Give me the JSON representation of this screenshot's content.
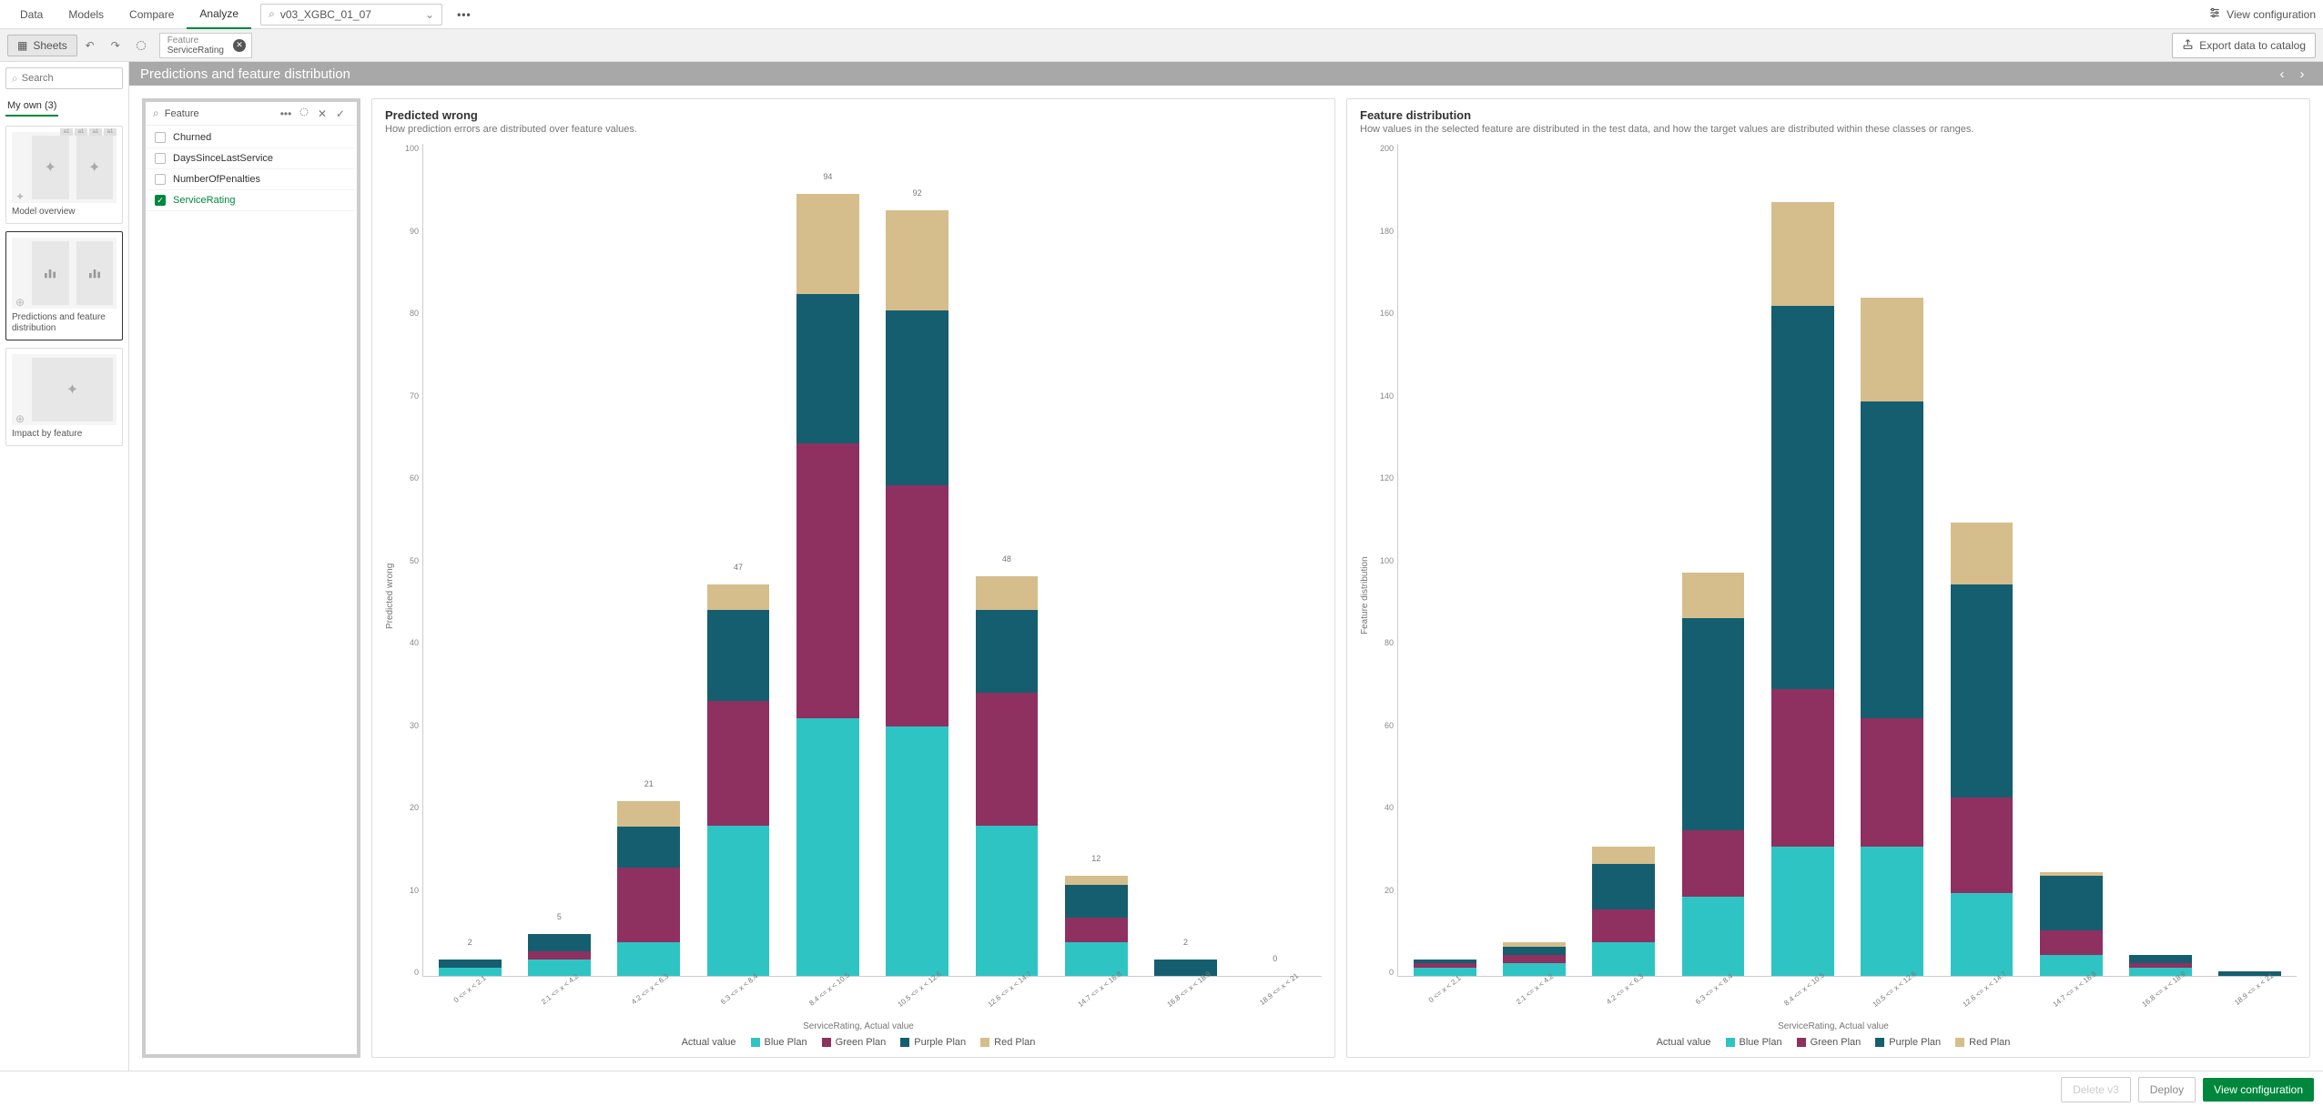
{
  "topnav": {
    "tabs": [
      "Data",
      "Models",
      "Compare",
      "Analyze"
    ],
    "active_tab": "Analyze",
    "model_dropdown": "v03_XGBC_01_07",
    "view_config": "View configuration"
  },
  "toolbar": {
    "sheets": "Sheets",
    "chip": {
      "label": "Feature",
      "value": "ServiceRating"
    },
    "export": "Export data to catalog"
  },
  "sidebar": {
    "search_placeholder": "Search",
    "myown": "My own (3)",
    "thumbs": [
      {
        "caption": "Model overview"
      },
      {
        "caption": "Predictions and feature distribution",
        "selected": true
      },
      {
        "caption": "Impact by feature"
      }
    ]
  },
  "header": {
    "title": "Predictions and feature distribution"
  },
  "feature_panel": {
    "title": "Feature",
    "items": [
      {
        "label": "Churned",
        "checked": false
      },
      {
        "label": "DaysSinceLastService",
        "checked": false
      },
      {
        "label": "NumberOfPenalties",
        "checked": false
      },
      {
        "label": "ServiceRating",
        "checked": true
      }
    ]
  },
  "legend": {
    "title": "Actual value",
    "series": [
      "Blue Plan",
      "Green Plan",
      "Purple Plan",
      "Red Plan"
    ],
    "colors": {
      "Blue Plan": "#2fc4c4",
      "Green Plan": "#8e3060",
      "Purple Plan": "#155e6f",
      "Red Plan": "#d6bd8c"
    }
  },
  "xlabel": "ServiceRating, Actual value",
  "chart_data": [
    {
      "title": "Predicted wrong",
      "subtitle": "How prediction errors are distributed over feature values.",
      "ylabel": "Predicted wrong",
      "ylim": [
        0,
        100
      ],
      "yticks": [
        0,
        10,
        20,
        30,
        40,
        50,
        60,
        70,
        80,
        90,
        100
      ],
      "type": "bar",
      "categories": [
        "0 <= x < 2.1",
        "2.1 <= x < 4.2",
        "4.2 <= x < 6.3",
        "6.3 <= x < 8.4",
        "8.4 <= x < 10.5",
        "10.5 <= x < 12.6",
        "12.6 <= x < 14.7",
        "14.7 <= x < 16.8",
        "16.8 <= x < 18.9",
        "18.9 <= x < 21"
      ],
      "totals": [
        2,
        5,
        21,
        47,
        94,
        92,
        48,
        12,
        2,
        0
      ],
      "series": [
        {
          "name": "Blue Plan",
          "values": [
            1,
            2,
            4,
            18,
            31,
            30,
            18,
            4,
            0,
            0
          ]
        },
        {
          "name": "Green Plan",
          "values": [
            0,
            1,
            9,
            15,
            33,
            29,
            16,
            3,
            0,
            0
          ]
        },
        {
          "name": "Purple Plan",
          "values": [
            1,
            2,
            5,
            11,
            18,
            21,
            10,
            4,
            2,
            0
          ]
        },
        {
          "name": "Red Plan",
          "values": [
            0,
            0,
            3,
            3,
            12,
            12,
            4,
            1,
            0,
            0
          ]
        }
      ]
    },
    {
      "title": "Feature distribution",
      "subtitle": "How values in the selected feature are distributed in the test data, and how the target values are distributed within these classes or ranges.",
      "ylabel": "Feature distribution",
      "ylim": [
        0,
        200
      ],
      "yticks": [
        0,
        20,
        40,
        60,
        80,
        100,
        120,
        140,
        160,
        180,
        200
      ],
      "type": "bar",
      "categories": [
        "0 <= x < 2.1",
        "2.1 <= x < 4.2",
        "4.2 <= x < 6.3",
        "6.3 <= x < 8.4",
        "8.4 <= x < 10.5",
        "10.5 <= x < 12.6",
        "12.6 <= x < 14.7",
        "14.7 <= x < 16.8",
        "16.8 <= x < 18.9",
        "18.9 <= x < 21"
      ],
      "totals": [
        4,
        8,
        31,
        97,
        186,
        163,
        109,
        25,
        5,
        1
      ],
      "series": [
        {
          "name": "Blue Plan",
          "values": [
            2,
            3,
            8,
            19,
            31,
            31,
            20,
            5,
            2,
            0
          ]
        },
        {
          "name": "Green Plan",
          "values": [
            1,
            2,
            8,
            16,
            38,
            31,
            23,
            6,
            1,
            0
          ]
        },
        {
          "name": "Purple Plan",
          "values": [
            1,
            2,
            11,
            51,
            92,
            76,
            51,
            13,
            2,
            1
          ]
        },
        {
          "name": "Red Plan",
          "values": [
            0,
            1,
            4,
            11,
            25,
            25,
            15,
            1,
            0,
            0
          ]
        }
      ]
    }
  ],
  "footer": {
    "delete": "Delete v3",
    "deploy": "Deploy",
    "view": "View configuration"
  }
}
